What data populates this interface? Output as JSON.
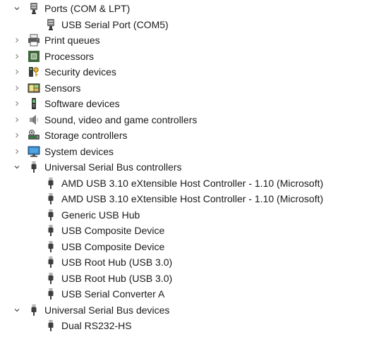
{
  "rows": [
    {
      "level": 0,
      "expander": "expanded",
      "icon": "port-icon",
      "label": "Ports (COM & LPT)"
    },
    {
      "level": 1,
      "expander": "none",
      "icon": "serial-port-icon",
      "label": "USB Serial Port (COM5)"
    },
    {
      "level": 0,
      "expander": "collapsed",
      "icon": "printer-icon",
      "label": "Print queues"
    },
    {
      "level": 0,
      "expander": "collapsed",
      "icon": "processor-icon",
      "label": "Processors"
    },
    {
      "level": 0,
      "expander": "collapsed",
      "icon": "security-key-icon",
      "label": "Security devices"
    },
    {
      "level": 0,
      "expander": "collapsed",
      "icon": "sensor-icon",
      "label": "Sensors"
    },
    {
      "level": 0,
      "expander": "collapsed",
      "icon": "software-device-icon",
      "label": "Software devices"
    },
    {
      "level": 0,
      "expander": "collapsed",
      "icon": "speaker-icon",
      "label": "Sound, video and game controllers"
    },
    {
      "level": 0,
      "expander": "collapsed",
      "icon": "storage-icon",
      "label": "Storage controllers"
    },
    {
      "level": 0,
      "expander": "collapsed",
      "icon": "monitor-icon",
      "label": "System devices"
    },
    {
      "level": 0,
      "expander": "expanded",
      "icon": "usb-plug-icon",
      "label": "Universal Serial Bus controllers"
    },
    {
      "level": 1,
      "expander": "none",
      "icon": "usb-plug-icon",
      "label": "AMD USB 3.10 eXtensible Host Controller - 1.10 (Microsoft)"
    },
    {
      "level": 1,
      "expander": "none",
      "icon": "usb-plug-icon",
      "label": "AMD USB 3.10 eXtensible Host Controller - 1.10 (Microsoft)"
    },
    {
      "level": 1,
      "expander": "none",
      "icon": "usb-plug-icon",
      "label": "Generic USB Hub"
    },
    {
      "level": 1,
      "expander": "none",
      "icon": "usb-plug-icon",
      "label": "USB Composite Device"
    },
    {
      "level": 1,
      "expander": "none",
      "icon": "usb-plug-icon",
      "label": "USB Composite Device"
    },
    {
      "level": 1,
      "expander": "none",
      "icon": "usb-plug-icon",
      "label": "USB Root Hub (USB 3.0)"
    },
    {
      "level": 1,
      "expander": "none",
      "icon": "usb-plug-icon",
      "label": "USB Root Hub (USB 3.0)"
    },
    {
      "level": 1,
      "expander": "none",
      "icon": "usb-plug-icon",
      "label": "USB Serial Converter A"
    },
    {
      "level": 0,
      "expander": "expanded",
      "icon": "usb-plug-icon",
      "label": "Universal Serial Bus devices"
    },
    {
      "level": 1,
      "expander": "none",
      "icon": "usb-plug-icon",
      "label": "Dual RS232-HS"
    }
  ]
}
